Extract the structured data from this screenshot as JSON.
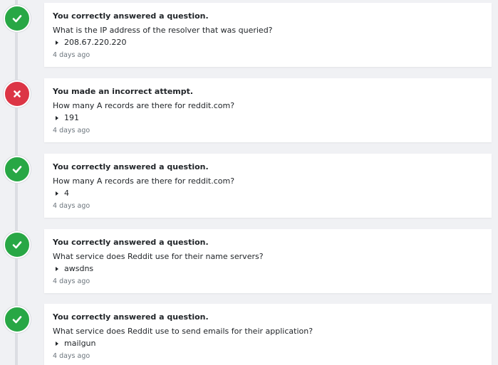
{
  "colors": {
    "correct": "#28a745",
    "incorrect": "#dc3545"
  },
  "entries": [
    {
      "result": "correct",
      "icon": "check-icon",
      "status": "You correctly answered a question.",
      "question": "What is the IP address of the resolver that was queried?",
      "answer": "208.67.220.220",
      "timestamp": "4 days ago"
    },
    {
      "result": "incorrect",
      "icon": "x-icon",
      "status": "You made an incorrect attempt.",
      "question": "How many A records are there for reddit.com?",
      "answer": "191",
      "timestamp": "4 days ago"
    },
    {
      "result": "correct",
      "icon": "check-icon",
      "status": "You correctly answered a question.",
      "question": "How many A records are there for reddit.com?",
      "answer": "4",
      "timestamp": "4 days ago"
    },
    {
      "result": "correct",
      "icon": "check-icon",
      "status": "You correctly answered a question.",
      "question": "What service does Reddit use for their name servers?",
      "answer": "awsdns",
      "timestamp": "4 days ago"
    },
    {
      "result": "correct",
      "icon": "check-icon",
      "status": "You correctly answered a question.",
      "question": "What service does Reddit use to send emails for their application?",
      "answer": "mailgun",
      "timestamp": "4 days ago"
    }
  ]
}
